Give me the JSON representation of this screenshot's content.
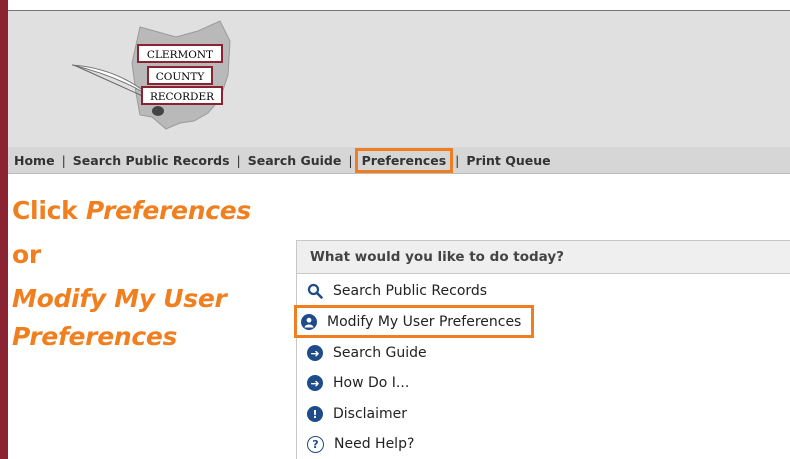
{
  "logo": {
    "lines": [
      "CLERMONT",
      "COUNTY",
      "RECORDER"
    ],
    "colors": {
      "outline": "#8a2432",
      "state": "#b9b9b9"
    }
  },
  "nav": {
    "items": [
      {
        "label": "Home"
      },
      {
        "label": "Search Public Records"
      },
      {
        "label": "Search Guide"
      },
      {
        "label": "Preferences",
        "highlighted": true
      },
      {
        "label": "Print Queue"
      }
    ],
    "separator": "|"
  },
  "instruction": {
    "line1_prefix": "Click ",
    "line1_em": "Preferences",
    "line2": "or",
    "line3": "Modify My User",
    "line4": "Preferences"
  },
  "panel": {
    "title": "What would you like to do today?",
    "items": [
      {
        "label": "Search Public Records",
        "icon": "search-icon"
      },
      {
        "label": "Modify My User Preferences",
        "icon": "user-icon",
        "highlighted": true
      },
      {
        "label": "Search Guide",
        "icon": "arrow-right-icon"
      },
      {
        "label": "How Do I...",
        "icon": "arrow-right-icon"
      },
      {
        "label": "Disclaimer",
        "icon": "exclamation-icon"
      },
      {
        "label": "Need Help?",
        "icon": "question-icon"
      }
    ]
  },
  "colors": {
    "accent_orange": "#ef7d22",
    "brand_maroon": "#8a2432",
    "icon_blue": "#1e4b8a"
  }
}
